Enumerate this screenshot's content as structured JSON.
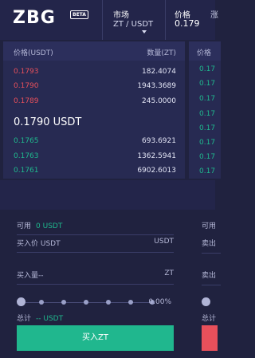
{
  "header": {
    "logo": "ZBG",
    "badge": "BETA",
    "market_label": "市场",
    "market_pair": "ZT / USDT",
    "price_label": "价格",
    "price_value": "0.179",
    "cut_label": "涨"
  },
  "orderbook": {
    "col_price": "价格(USDT)",
    "col_amount": "数量(ZT)",
    "asks": [
      {
        "price": "0.1793",
        "amount": "182.4074"
      },
      {
        "price": "0.1790",
        "amount": "1943.3689"
      },
      {
        "price": "0.1789",
        "amount": "245.0000"
      }
    ],
    "last_price": "0.1790 USDT",
    "bids": [
      {
        "price": "0.1765",
        "amount": "693.6921"
      },
      {
        "price": "0.1763",
        "amount": "1362.5941"
      },
      {
        "price": "0.1761",
        "amount": "6902.6013"
      }
    ]
  },
  "orderbook_right": {
    "col_price": "价格",
    "values": [
      "0.17",
      "0.17",
      "0.17",
      "0.17",
      "0.17",
      "0.17",
      "0.17",
      "0.17",
      "0.17"
    ]
  },
  "buy_form": {
    "available_label": "可用",
    "available_value": "0 USDT",
    "price_label": "买入价 USDT",
    "price_unit": "USDT",
    "amount_label": "买入量--",
    "amount_unit": "ZT",
    "slider_percent": "0.00%",
    "total_label": "总计",
    "total_value": "-- USDT",
    "button_label": "买入ZT"
  },
  "sell_form": {
    "available_label": "可用",
    "price_label": "卖出",
    "amount_label": "卖出",
    "total_label": "总计"
  },
  "colors": {
    "buy": "#20b78e",
    "sell": "#e8505b",
    "background": "#20223f"
  }
}
